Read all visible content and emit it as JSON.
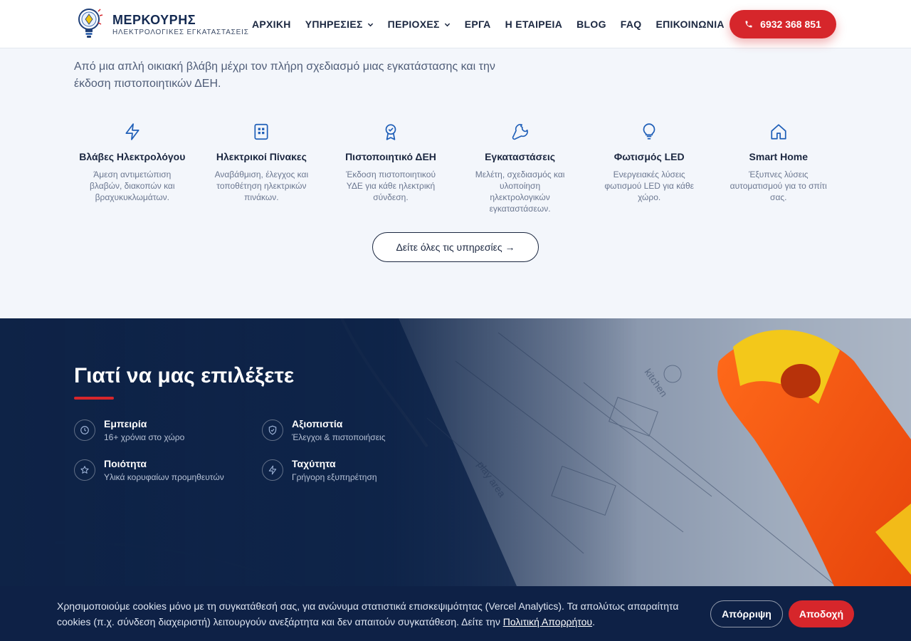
{
  "brand": {
    "name": "ΜΕΡΚΟΥΡΗΣ",
    "tagline": "ΗΛΕΚΤΡΟΛΟΓΙΚΕΣ ΕΓΚΑΤΑΣΤΑΣΕΙΣ",
    "accent_color": "#d6262b",
    "navy_color": "#142a52"
  },
  "nav": {
    "items": [
      {
        "label": "ΑΡΧΙΚΗ",
        "dropdown": false
      },
      {
        "label": "ΥΠΗΡΕΣΙΕΣ",
        "dropdown": true
      },
      {
        "label": "ΠΕΡΙΟΧΕΣ",
        "dropdown": true
      },
      {
        "label": "ΕΡΓΑ",
        "dropdown": false
      },
      {
        "label": "Η ΕΤΑΙΡΕΙΑ",
        "dropdown": false
      },
      {
        "label": "BLOG",
        "dropdown": false
      },
      {
        "label": "FAQ",
        "dropdown": false
      },
      {
        "label": "ΕΠΙΚΟΙΝΩΝΙΑ",
        "dropdown": false
      }
    ],
    "phone": "6932 368 851"
  },
  "services": {
    "intro": "Από μια απλή οικιακή βλάβη μέχρι τον πλήρη σχεδιασμό μιας εγκατάστασης και την έκδοση πιστοποιητικών ΔΕΗ.",
    "items": [
      {
        "icon": "lightning-icon",
        "title": "Βλάβες Ηλεκτρολόγου",
        "desc": "Άμεση αντιμετώπιση βλαβών, διακοπών και βραχυκυκλωμάτων."
      },
      {
        "icon": "panel-icon",
        "title": "Ηλεκτρικοί Πίνακες",
        "desc": "Αναβάθμιση, έλεγχος και τοποθέτηση ηλεκτρικών πινάκων."
      },
      {
        "icon": "award-icon",
        "title": "Πιστοποιητικό ΔΕΗ",
        "desc": "Έκδοση πιστοποιητικού ΥΔΕ για κάθε ηλεκτρική σύνδεση."
      },
      {
        "icon": "wrench-icon",
        "title": "Εγκαταστάσεις",
        "desc": "Μελέτη, σχεδιασμός και υλοποίηση ηλεκτρολογικών εγκαταστάσεων."
      },
      {
        "icon": "lightbulb-icon",
        "title": "Φωτισμός LED",
        "desc": "Ενεργειακές λύσεις φωτισμού LED για κάθε χώρο."
      },
      {
        "icon": "home-icon",
        "title": "Smart Home",
        "desc": "Έξυπνες λύσεις αυτοματισμού για το σπίτι σας."
      }
    ],
    "all_button": "Δείτε όλες τις υπηρεσίες →"
  },
  "why": {
    "title": "Γιατί να μας επιλέξετε",
    "features": [
      {
        "icon": "clock-icon",
        "title": "Εμπειρία",
        "sub": "16+ χρόνια στο χώρο"
      },
      {
        "icon": "shield-check-icon",
        "title": "Αξιοπιστία",
        "sub": "Έλεγχοι & πιστοποιήσεις"
      },
      {
        "icon": "star-icon",
        "title": "Ποιότητα",
        "sub": "Υλικά κορυφαίων προμηθευτών"
      },
      {
        "icon": "lightning-icon",
        "title": "Ταχύτητα",
        "sub": "Γρήγορη εξυπηρέτηση"
      }
    ]
  },
  "cookie": {
    "text": "Χρησιμοποιούμε cookies μόνο με τη συγκατάθεσή σας, για ανώνυμα στατιστικά επισκεψιμότητας (Vercel Analytics). Τα απολύτως απαραίτητα cookies (π.χ. σύνδεση διαχειριστή) λειτουργούν ανεξάρτητα και δεν απαιτούν συγκατάθεση. Δείτε την ",
    "link": "Πολιτική Απορρήτου",
    "end": ".",
    "reject": "Απόρριψη",
    "accept": "Αποδοχή"
  }
}
